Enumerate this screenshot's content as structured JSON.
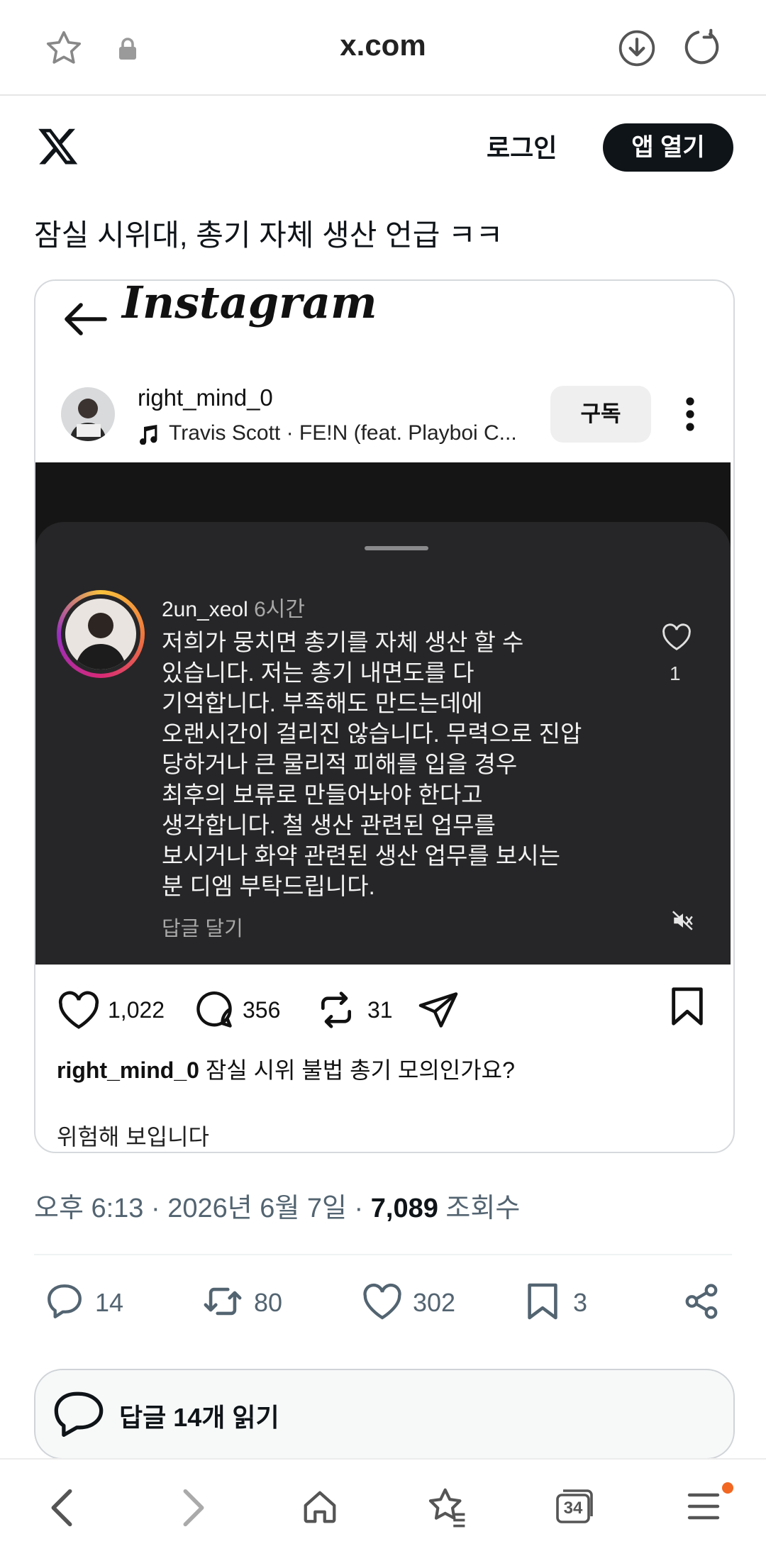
{
  "browser": {
    "url": "x.com",
    "tab_count": "34",
    "icons": [
      "star-icon",
      "lock-icon",
      "download-icon",
      "refresh-icon"
    ]
  },
  "header": {
    "login_label": "로그인",
    "open_app_label": "앱 열기"
  },
  "tweet": {
    "text": "잠실 시위대, 총기 자체 생산 언급 ㅋㅋ",
    "time": "오후 6:13 · 2026년 6월 7일 · ",
    "views_count": "7,089",
    "views_label": " 조회수",
    "actions": {
      "replies": "14",
      "retweets": "80",
      "likes": "302",
      "bookmarks": "3"
    },
    "read_replies_label": "답글 14개 읽기"
  },
  "instagram_card": {
    "app_name": "Instagram",
    "username": "right_mind_0",
    "music": "Travis Scott · FE!N (feat. Playboi C...",
    "subscribe_label": "구독",
    "comment": {
      "user": "2un_xeol",
      "time": "6시간",
      "text": "저희가 뭉치면 총기를 자체 생산 할 수\n있습니다. 저는 총기 내면도를 다\n기억합니다. 부족해도 만드는데에\n오랜시간이 걸리진 않습니다. 무력으로 진압\n당하거나 큰 물리적 피해를 입을 경우\n최후의 보류로 만들어놔야 한다고\n생각합니다. 철 생산 관련된 업무를\n보시거나 화약 관련된 생산 업무를 보시는\n분 디엠 부탁드립니다.",
      "reply_label": "답글 달기",
      "likes": "1"
    },
    "stats": {
      "likes": "1,022",
      "comments": "356",
      "reposts": "31"
    },
    "caption_user": "right_mind_0",
    "caption_text": " 잠실 시위 불법 총기 모의인가요?",
    "caption_line2": "위험해 보입니다"
  }
}
